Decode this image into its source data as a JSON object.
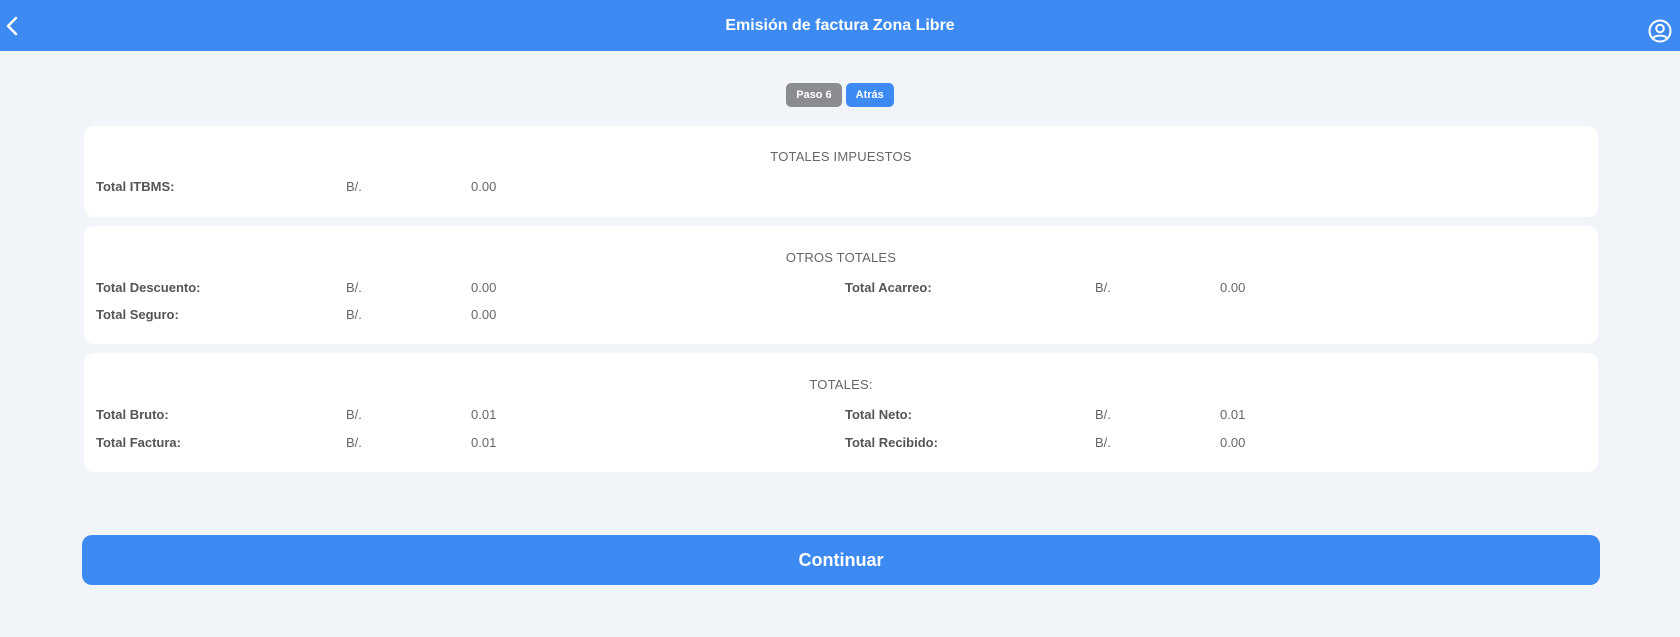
{
  "header": {
    "title": "Emisión de factura Zona Libre",
    "back_icon": "chevron-left-icon",
    "user_icon": "user-circle-icon"
  },
  "steps": {
    "current": "Paso 6",
    "back_label": "Atrás"
  },
  "currency": "B/.",
  "taxes": {
    "title": "TOTALES IMPUESTOS",
    "itbms_label": "Total ITBMS:",
    "itbms_value": "0.00"
  },
  "other_totals": {
    "title": "OTROS TOTALES",
    "discount_label": "Total Descuento:",
    "discount_value": "0.00",
    "freight_label": "Total Acarreo:",
    "freight_value": "0.00",
    "insurance_label": "Total Seguro:",
    "insurance_value": "0.00"
  },
  "totals": {
    "title": "TOTALES:",
    "gross_label": "Total Bruto:",
    "gross_value": "0.01",
    "net_label": "Total Neto:",
    "net_value": "0.01",
    "invoice_label": "Total Factura:",
    "invoice_value": "0.01",
    "received_label": "Total Recibido:",
    "received_value": "0.00"
  },
  "continue_label": "Continuar",
  "colors": {
    "primary": "#3d8af3",
    "background": "#f1f4f8",
    "step_grey": "#8a8c90"
  }
}
